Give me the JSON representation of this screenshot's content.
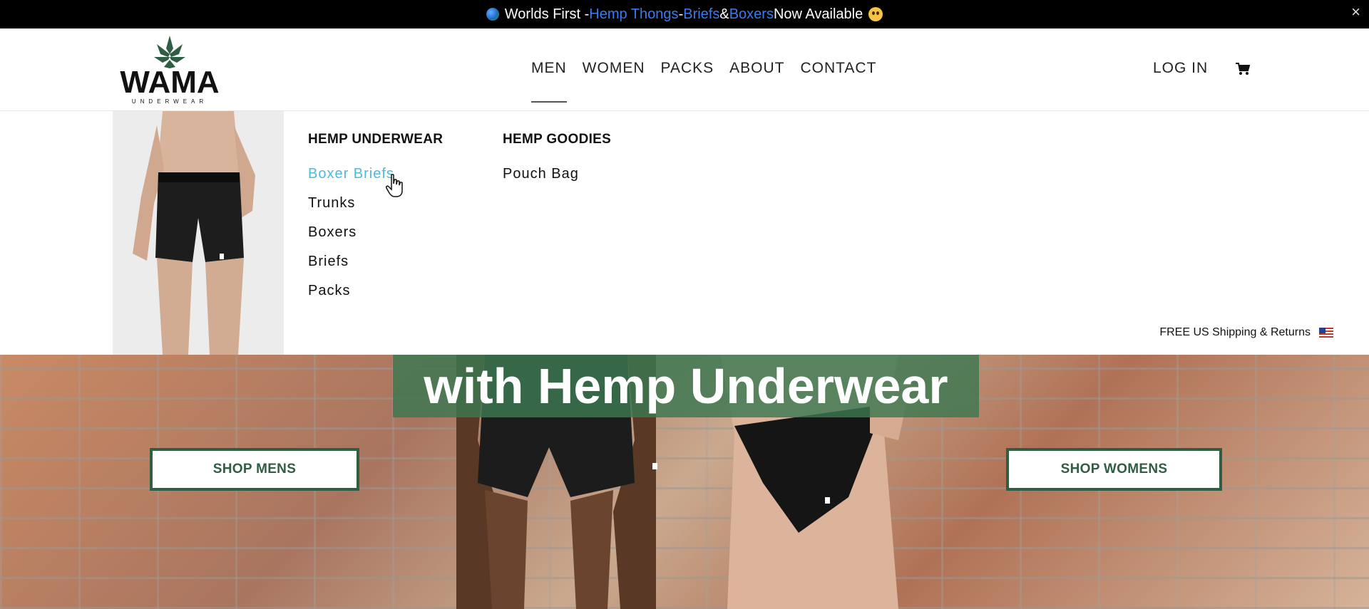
{
  "announcement": {
    "prefix": "Worlds First - ",
    "link1": "Hemp Thongs",
    "sep1": " - ",
    "link2": "Briefs",
    "sep2": " & ",
    "link3": "Boxers",
    "suffix": " Now Available",
    "close": "×"
  },
  "brand": {
    "name": "WAMA",
    "tagline": "UNDERWEAR",
    "accent": "#2f5e44"
  },
  "nav": {
    "items": [
      "MEN",
      "WOMEN",
      "PACKS",
      "ABOUT",
      "CONTACT"
    ],
    "active": "MEN"
  },
  "header": {
    "login": "LOG IN",
    "cart_icon": "cart-icon"
  },
  "megamenu": {
    "columns": [
      {
        "title": "HEMP UNDERWEAR",
        "links": [
          "Boxer Briefs",
          "Trunks",
          "Boxers",
          "Briefs",
          "Packs"
        ]
      },
      {
        "title": "HEMP GOODIES",
        "links": [
          "Pouch Bag"
        ]
      }
    ],
    "hovered": "Boxer Briefs",
    "hover_color": "#4fb8e0"
  },
  "shipping": {
    "text": "FREE US Shipping & Returns",
    "flag_icon": "us-flag-icon"
  },
  "hero": {
    "title": "with Hemp Underwear",
    "shop_mens": "SHOP MENS",
    "shop_womens": "SHOP WOMENS"
  }
}
